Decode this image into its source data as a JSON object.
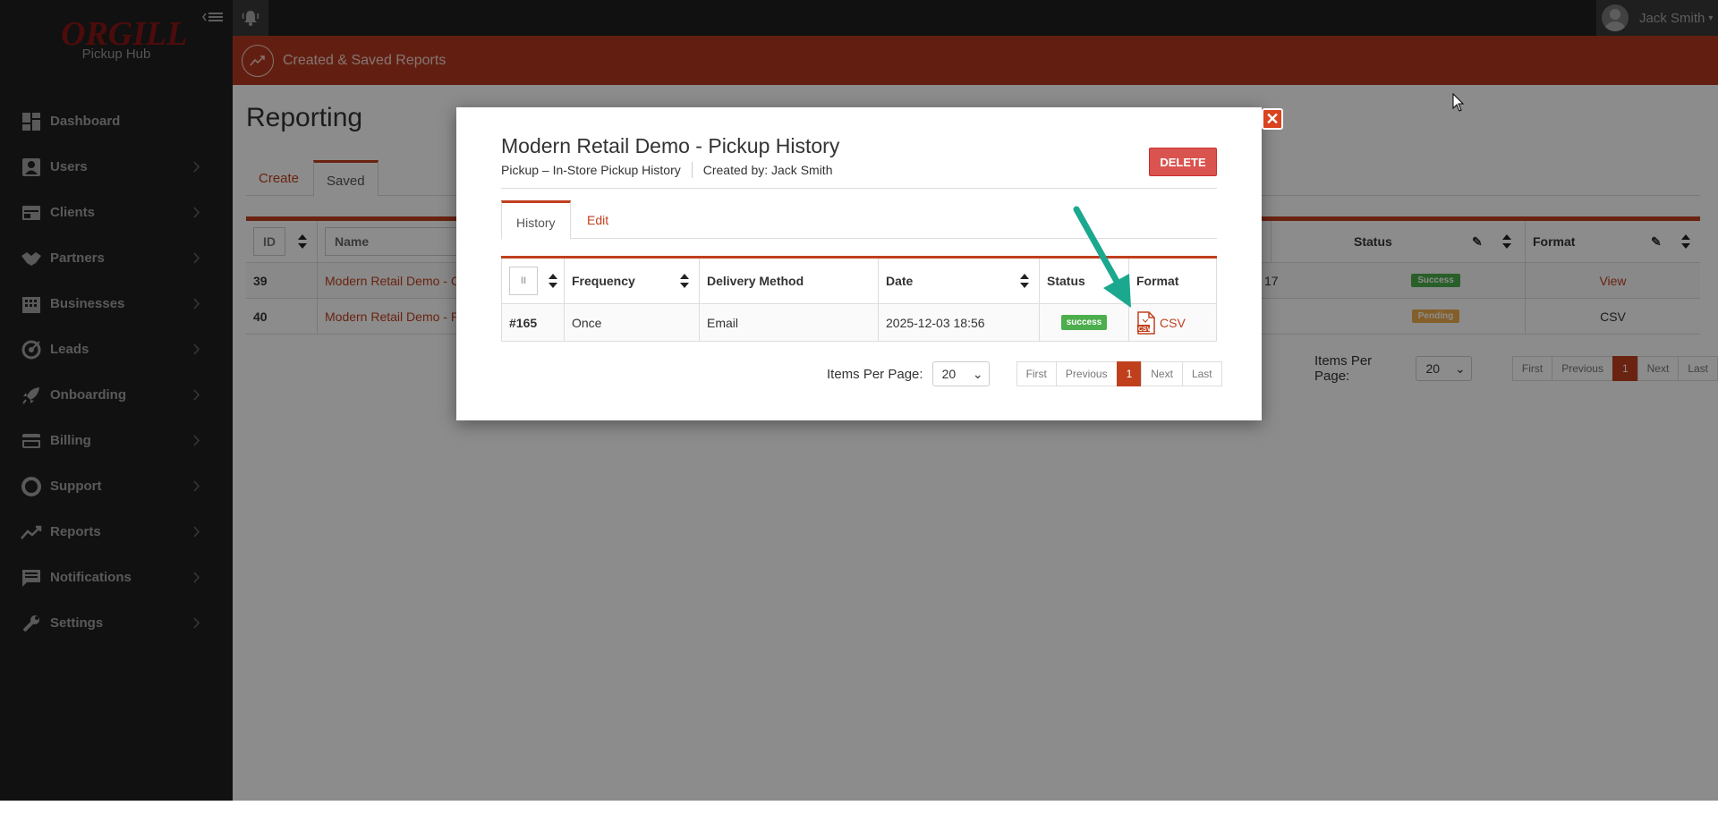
{
  "brand": {
    "logo": "ORGILL",
    "subtitle": "Pickup Hub"
  },
  "sidebar": {
    "items": [
      {
        "label": "Dashboard",
        "icon": "dashboard-icon"
      },
      {
        "label": "Users",
        "icon": "user-icon"
      },
      {
        "label": "Clients",
        "icon": "clients-icon"
      },
      {
        "label": "Partners",
        "icon": "handshake-icon"
      },
      {
        "label": "Businesses",
        "icon": "building-icon"
      },
      {
        "label": "Leads",
        "icon": "target-icon"
      },
      {
        "label": "Onboarding",
        "icon": "rocket-icon"
      },
      {
        "label": "Billing",
        "icon": "credit-card-icon"
      },
      {
        "label": "Support",
        "icon": "lifebuoy-icon"
      },
      {
        "label": "Reports",
        "icon": "chart-line-icon"
      },
      {
        "label": "Notifications",
        "icon": "message-icon"
      },
      {
        "label": "Settings",
        "icon": "wrench-icon"
      }
    ]
  },
  "topbar": {
    "user_name": "Jack Smith"
  },
  "subheader": {
    "title": "Created & Saved Reports"
  },
  "page": {
    "title": "Reporting",
    "tabs": [
      "Create",
      "Saved"
    ],
    "table": {
      "headers": {
        "id": "ID",
        "name": "Name",
        "status": "Status",
        "format": "Format"
      },
      "partial_value": "17",
      "rows": [
        {
          "id": "39",
          "name": "Modern Retail Demo - C",
          "status": "Success",
          "format": "View"
        },
        {
          "id": "40",
          "name": "Modern Retail Demo - P",
          "status": "Pending",
          "format": "CSV"
        }
      ]
    },
    "pager": {
      "items_label": "Items Per Page:",
      "items_value": "20",
      "first": "First",
      "previous": "Previous",
      "current": "1",
      "next": "Next",
      "last": "Last"
    }
  },
  "modal": {
    "title": "Modern Retail Demo - Pickup History",
    "report_type": "Pickup – In-Store Pickup History",
    "created_by": "Created by: Jack Smith",
    "delete_label": "DELETE",
    "tabs": [
      "History",
      "Edit"
    ],
    "table": {
      "headers": {
        "col0": "II",
        "frequency": "Frequency",
        "delivery": "Delivery Method",
        "date": "Date",
        "status": "Status",
        "format": "Format"
      },
      "rows": [
        {
          "id": "#165",
          "frequency": "Once",
          "delivery": "Email",
          "date": "2025-12-03 18:56",
          "status": "success",
          "format": "CSV"
        }
      ]
    },
    "pager": {
      "items_label": "Items Per Page:",
      "items_value": "20",
      "first": "First",
      "previous": "Previous",
      "current": "1",
      "next": "Next",
      "last": "Last"
    }
  },
  "colors": {
    "accent": "#c0401e",
    "sidebar_bg": "#1f1f1f",
    "success": "#4cae4c",
    "pending": "#f0ad4e",
    "arrow": "#1aa88f"
  }
}
